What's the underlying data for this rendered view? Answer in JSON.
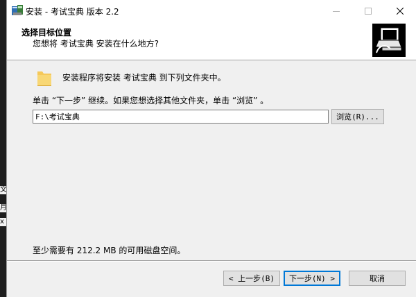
{
  "window": {
    "title": "安装 - 考试宝典 版本 2.2",
    "minimize_icon": "minimize-icon",
    "maximize_icon": "maximize-icon",
    "close_icon": "close-icon"
  },
  "header": {
    "title": "选择目标位置",
    "subtitle": "您想将 考试宝典 安装在什么地方?"
  },
  "body": {
    "intro_text": "安装程序将安装 考试宝典 到下列文件夹中。",
    "instruction_text": "单击 “下一步” 继续。如果您想选择其他文件夹，单击 “浏览” 。",
    "path_value": "F:\\考试宝典",
    "browse_label": "浏览(R)...",
    "space_text": "至少需要有 212.2 MB 的可用磁盘空间。"
  },
  "footer": {
    "back_label": "< 上一步(B)",
    "next_label": "下一步(N) >",
    "cancel_label": "取消"
  },
  "background_fragments": [
    "文",
    "月",
    "x"
  ],
  "colors": {
    "accent": "#0078d7",
    "header_bg": "#ffffff",
    "dialog_bg": "#f0f0f0",
    "folder": "#f5c85a"
  }
}
